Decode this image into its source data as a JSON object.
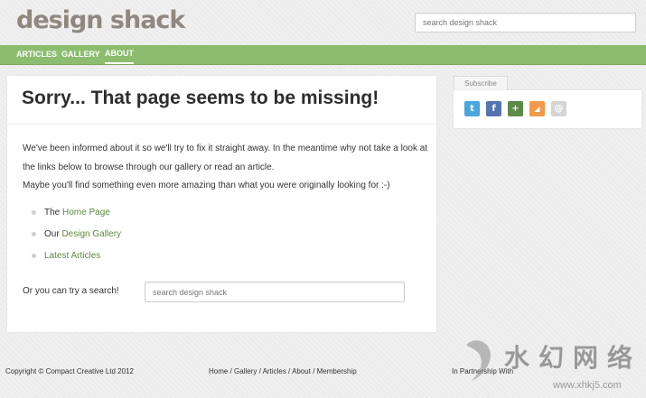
{
  "header": {
    "logo": "design shack",
    "search_placeholder": "search design shack"
  },
  "nav": {
    "items": [
      {
        "label": "ARTICLES"
      },
      {
        "label": "GALLERY"
      },
      {
        "label": "ABOUT",
        "active": true
      }
    ]
  },
  "main": {
    "title": "Sorry... That page seems to be missing!",
    "paragraph1": "We've been informed about it so we'll try to fix it straight away. In the meantime why not take a look at the links below to browse through our gallery or read an article.",
    "paragraph2": "Maybe you'll find something even more amazing than what you were originally looking for :-)",
    "links": [
      {
        "prefix": "The ",
        "link": "Home Page"
      },
      {
        "prefix": "Our ",
        "link": "Design Gallery"
      },
      {
        "prefix": "",
        "link": "Latest Articles"
      }
    ],
    "search_label": "Or you can try a search!",
    "search_placeholder": "search design shack"
  },
  "sidebar": {
    "subscribe_tab": "Subscribe",
    "social_icons": [
      {
        "name": "twitter-icon",
        "glyph": "t",
        "color": "#4aa6dd"
      },
      {
        "name": "facebook-icon",
        "glyph": "f",
        "color": "#5474b1"
      },
      {
        "name": "google-plus-icon",
        "glyph": "+",
        "color": "#5c8a4a"
      },
      {
        "name": "rss-icon",
        "glyph": "◢",
        "color": "#f39a4a"
      },
      {
        "name": "email-icon",
        "glyph": "@",
        "color": "#d6d6d6"
      }
    ]
  },
  "footer": {
    "copyright": "Copyright © Compact Creative Ltd 2012",
    "links": [
      "Home",
      "Gallery",
      "Articles",
      "About",
      "Membership"
    ],
    "separator": " / ",
    "partnership": "In Partnership With"
  },
  "colors": {
    "nav_green": "#8cbd6e",
    "link_green": "#5d8a3f",
    "logo_gray": "#8f887e"
  },
  "watermark": {
    "cjk": "水幻网络",
    "url": "www.xhkj5.com"
  }
}
